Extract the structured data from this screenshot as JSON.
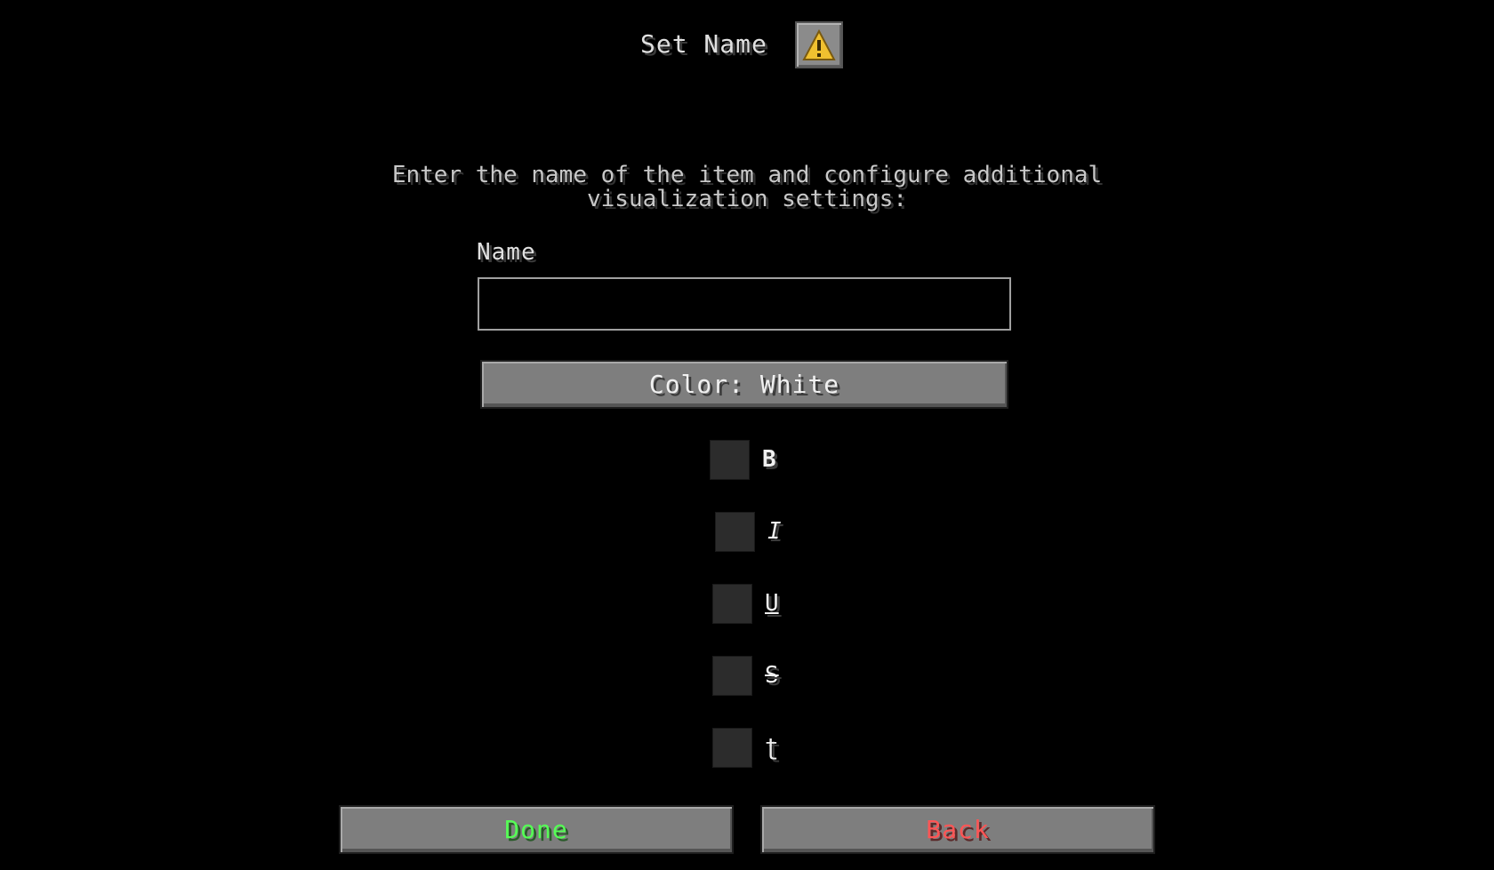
{
  "header": {
    "title": "Set Name",
    "warning_icon": "warning-triangle-icon",
    "warning_color": "#f0c030"
  },
  "description": "Enter the name of the item and configure additional visualization settings:",
  "name_field": {
    "label": "Name",
    "value": "",
    "placeholder": ""
  },
  "color_button": {
    "label": "Color: White"
  },
  "formatting": {
    "bold": {
      "label": "B",
      "checked": false
    },
    "italic": {
      "label": "I",
      "checked": false
    },
    "underline": {
      "label": "U",
      "checked": false
    },
    "strikethrough": {
      "label": "S",
      "checked": false
    },
    "obfuscated": {
      "label": "ʈ",
      "checked": false
    }
  },
  "footer": {
    "done_label": "Done",
    "back_label": "Back",
    "done_color": "#55ff55",
    "back_color": "#ff5555"
  }
}
